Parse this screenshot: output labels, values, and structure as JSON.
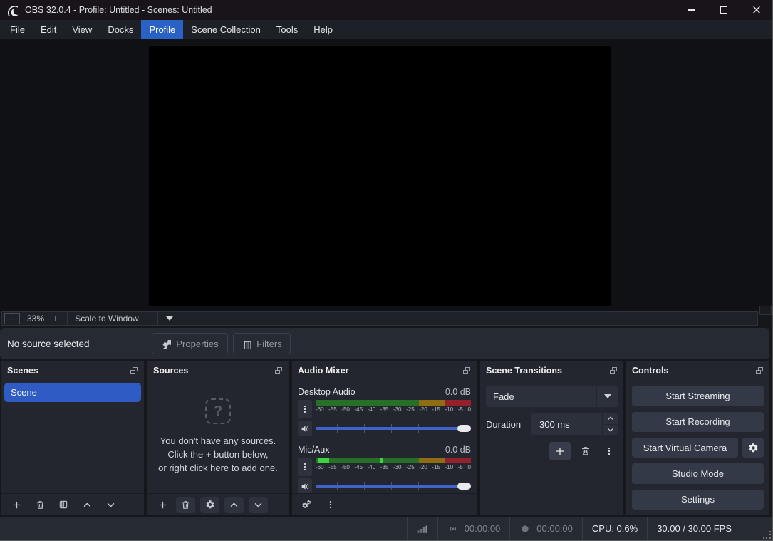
{
  "window": {
    "title": "OBS 32.0.4 - Profile: Untitled - Scenes: Untitled"
  },
  "menu": {
    "items": [
      "File",
      "Edit",
      "View",
      "Docks",
      "Profile",
      "Scene Collection",
      "Tools",
      "Help"
    ],
    "active": "Profile"
  },
  "preview": {
    "zoom_out": "−",
    "zoom_level": "33%",
    "zoom_in": "+",
    "scale_mode": "Scale to Window"
  },
  "source_bar": {
    "message": "No source selected",
    "properties": "Properties",
    "filters": "Filters"
  },
  "scenes": {
    "title": "Scenes",
    "items": [
      "Scene"
    ]
  },
  "sources": {
    "title": "Sources",
    "empty_icon": "?",
    "empty_line1": "You don't have any sources.",
    "empty_line2": "Click the + button below,",
    "empty_line3": "or right click here to add one."
  },
  "audio_mixer": {
    "title": "Audio Mixer",
    "scale": [
      "-60",
      "-55",
      "-50",
      "-45",
      "-40",
      "-35",
      "-30",
      "-25",
      "-20",
      "-15",
      "-10",
      "-5",
      "0"
    ],
    "channels": [
      {
        "name": "Desktop Audio",
        "level": "0.0 dB"
      },
      {
        "name": "Mic/Aux",
        "level": "0.0 dB"
      }
    ]
  },
  "transitions": {
    "title": "Scene Transitions",
    "selected": "Fade",
    "duration_label": "Duration",
    "duration_value": "300 ms"
  },
  "controls": {
    "title": "Controls",
    "start_streaming": "Start Streaming",
    "start_recording": "Start Recording",
    "start_virtual_camera": "Start Virtual Camera",
    "studio_mode": "Studio Mode",
    "settings": "Settings"
  },
  "status_bar": {
    "stream_time": "00:00:00",
    "record_time": "00:00:00",
    "cpu": "CPU: 0.6%",
    "fps": "30.00 / 30.00 FPS"
  },
  "colors": {
    "accent": "#2a61c4",
    "selection": "#2f5cc4",
    "slider": "#3f63c9",
    "meter_green": "#267127",
    "meter_yellow": "#8f6d11",
    "meter_red": "#94202c"
  }
}
